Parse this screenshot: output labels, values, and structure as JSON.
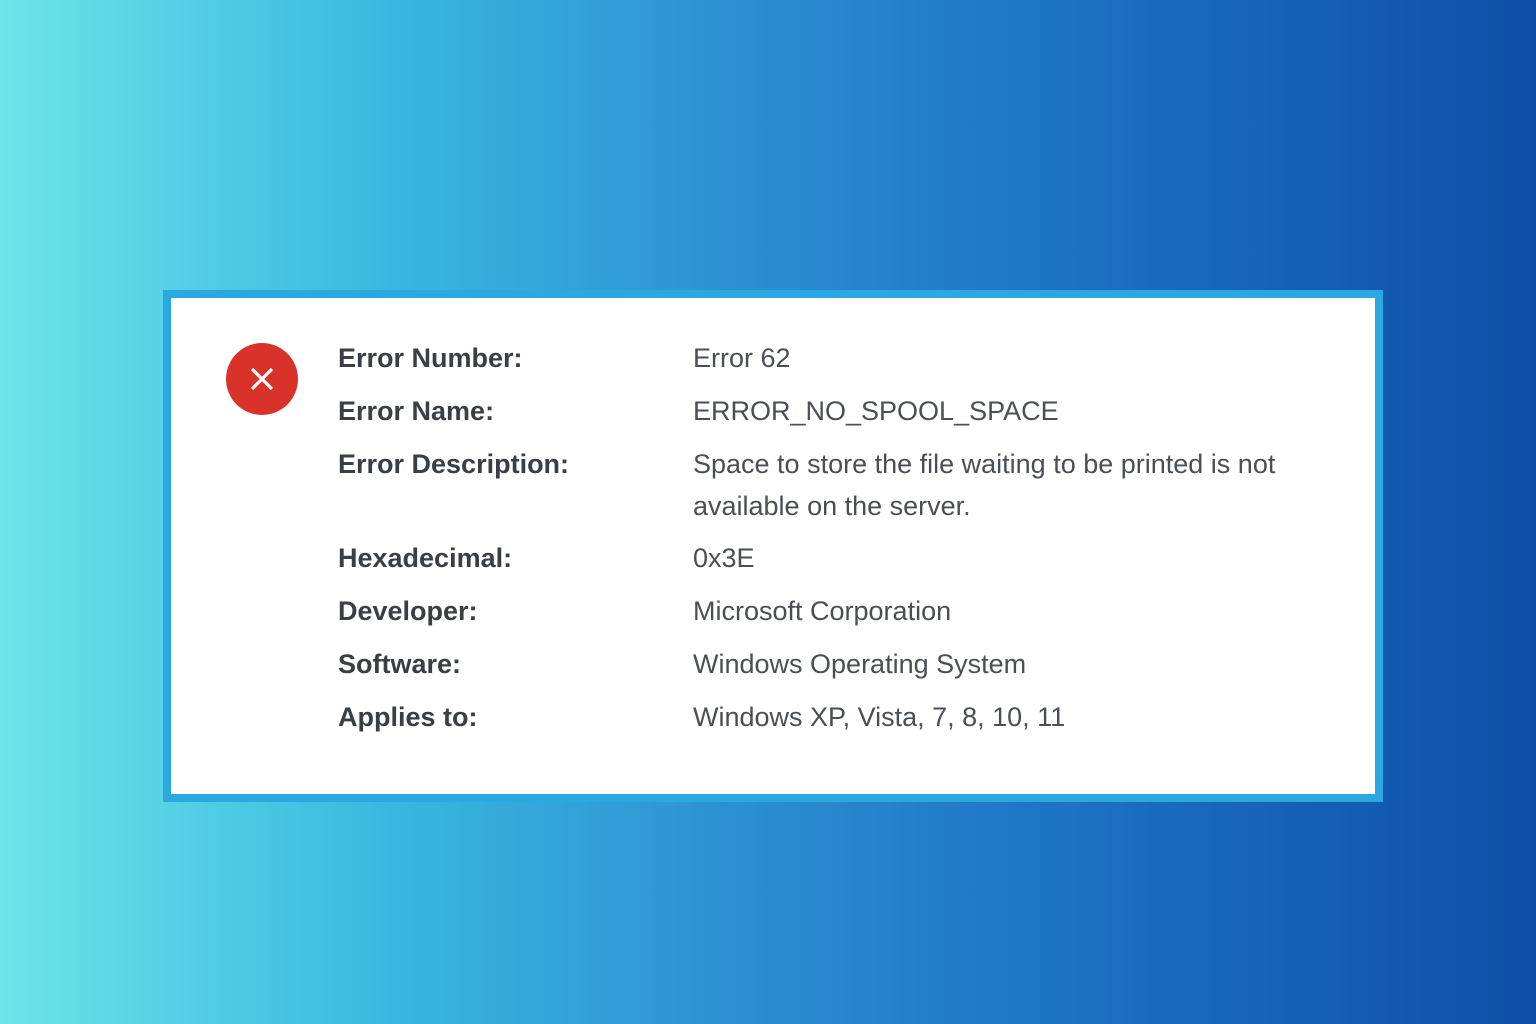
{
  "error": {
    "rows": [
      {
        "label": "Error Number:",
        "value": "Error 62"
      },
      {
        "label": "Error Name:",
        "value": "ERROR_NO_SPOOL_SPACE"
      },
      {
        "label": "Error Description:",
        "value": "Space to store the file waiting to be printed is not available on the server."
      },
      {
        "label": "Hexadecimal:",
        "value": "0x3E"
      },
      {
        "label": "Developer:",
        "value": "Microsoft Corporation"
      },
      {
        "label": "Software:",
        "value": "Windows Operating System"
      },
      {
        "label": "Applies to:",
        "value": "Windows XP, Vista, 7, 8, 10, 11"
      }
    ]
  }
}
